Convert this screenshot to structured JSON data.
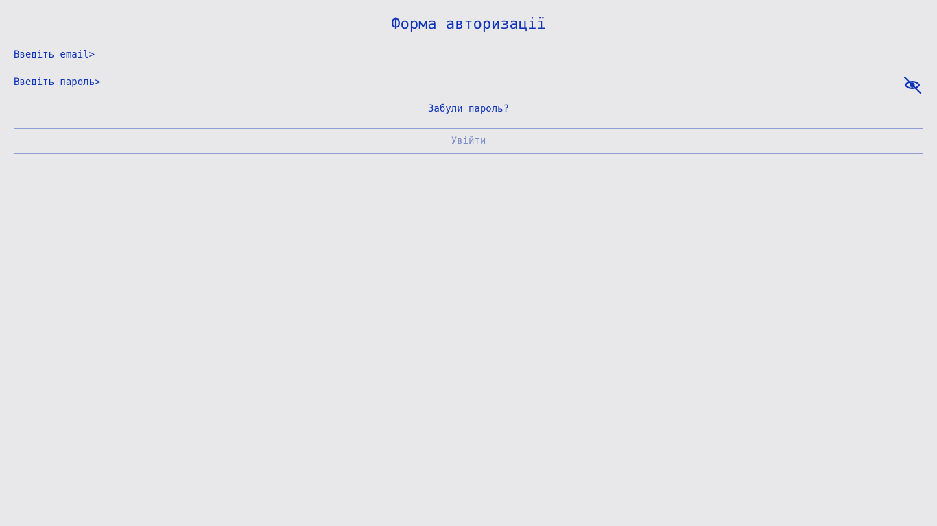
{
  "form": {
    "title": "Форма авторизації",
    "email_placeholder": "Введіть email>",
    "email_value": "",
    "password_placeholder": "Введіть пароль>",
    "password_value": "",
    "password_visibility_icon": "eye-slash-icon",
    "forgot_password_label": "Забули пароль?",
    "submit_label": "Увійти",
    "submit_disabled": true
  },
  "colors": {
    "background": "#e8e8eb",
    "accent": "#0f34b8",
    "button_border": "#8e9dd3",
    "button_text": "#7c8cc6"
  }
}
